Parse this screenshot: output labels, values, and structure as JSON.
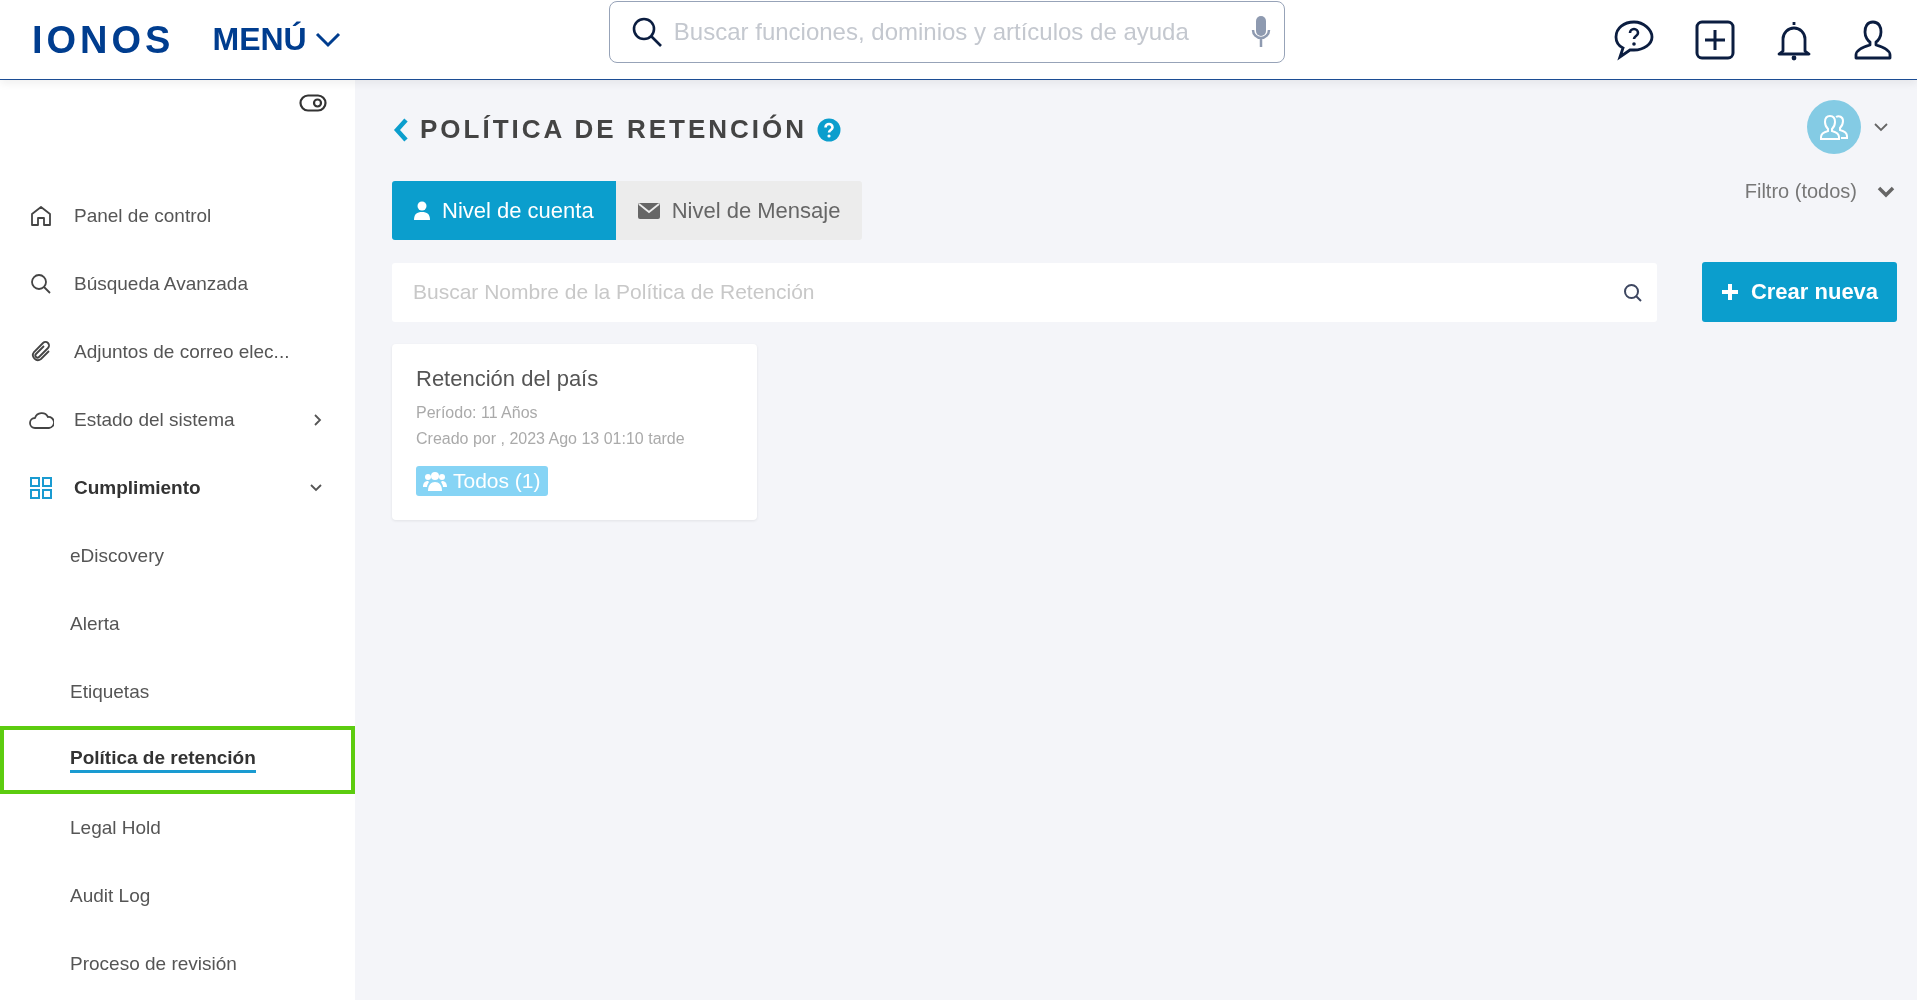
{
  "header": {
    "logo": "IONOS",
    "menu_label": "MENÚ",
    "search": {
      "placeholder": "Buscar funciones, dominios y artículos de ayuda"
    }
  },
  "sidebar": {
    "items": [
      {
        "label": "Panel de control",
        "selected": false
      },
      {
        "label": "Búsqueda Avanzada",
        "selected": false
      },
      {
        "label": "Adjuntos de correo elec...",
        "selected": false
      },
      {
        "label": "Estado del sistema",
        "selected": false,
        "expanded": false
      },
      {
        "label": "Cumplimiento",
        "selected": false,
        "expanded": true,
        "children": [
          {
            "label": "eDiscovery",
            "selected": false
          },
          {
            "label": "Alerta",
            "selected": false
          },
          {
            "label": "Etiquetas",
            "selected": false
          },
          {
            "label": "Política de retención",
            "selected": true
          },
          {
            "label": "Legal Hold",
            "selected": false
          },
          {
            "label": "Audit Log",
            "selected": false
          },
          {
            "label": "Proceso de revisión",
            "selected": false
          }
        ]
      }
    ]
  },
  "page": {
    "title": "POLÍTICA DE RETENCIÓN",
    "filter": "Filtro (todos)",
    "tabs": [
      {
        "label": "Nivel de cuenta",
        "selected": true
      },
      {
        "label": "Nivel de Mensaje",
        "selected": false
      }
    ],
    "search": {
      "placeholder": "Buscar Nombre de la Política de Retención"
    },
    "create_button": "Crear nueva",
    "policies": [
      {
        "name": "Retención del país",
        "period": "Período: 11 Años",
        "created": "Creado por , 2023 Ago 13 01:10 tarde",
        "tag": "Todos (1)"
      }
    ]
  }
}
